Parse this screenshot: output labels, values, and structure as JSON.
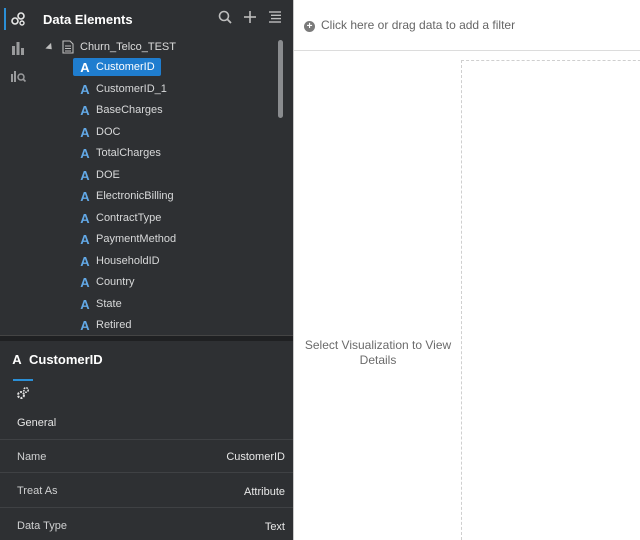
{
  "panel": {
    "title": "Data Elements",
    "dataset": "Churn_Telco_TEST",
    "items": [
      {
        "label": "CustomerID"
      },
      {
        "label": "CustomerID_1"
      },
      {
        "label": "BaseCharges"
      },
      {
        "label": "DOC"
      },
      {
        "label": "TotalCharges"
      },
      {
        "label": "DOE"
      },
      {
        "label": "ElectronicBilling"
      },
      {
        "label": "ContractType"
      },
      {
        "label": "PaymentMethod"
      },
      {
        "label": "HouseholdID"
      },
      {
        "label": "Country"
      },
      {
        "label": "State"
      },
      {
        "label": "Retired"
      }
    ],
    "attribute_glyph": "A"
  },
  "properties": {
    "title": "CustomerID",
    "section": "General",
    "rows": [
      {
        "label": "Name",
        "value": "CustomerID"
      },
      {
        "label": "Treat As",
        "value": "Attribute"
      },
      {
        "label": "Data Type",
        "value": "Text"
      }
    ]
  },
  "canvas": {
    "filter_text": "Click here or drag data to add a filter",
    "placeholder": "Select Visualization to View Details"
  },
  "colors": {
    "panel_bg": "#2e3033",
    "accent": "#1f7dcf",
    "attr_icon": "#62a8e6"
  }
}
